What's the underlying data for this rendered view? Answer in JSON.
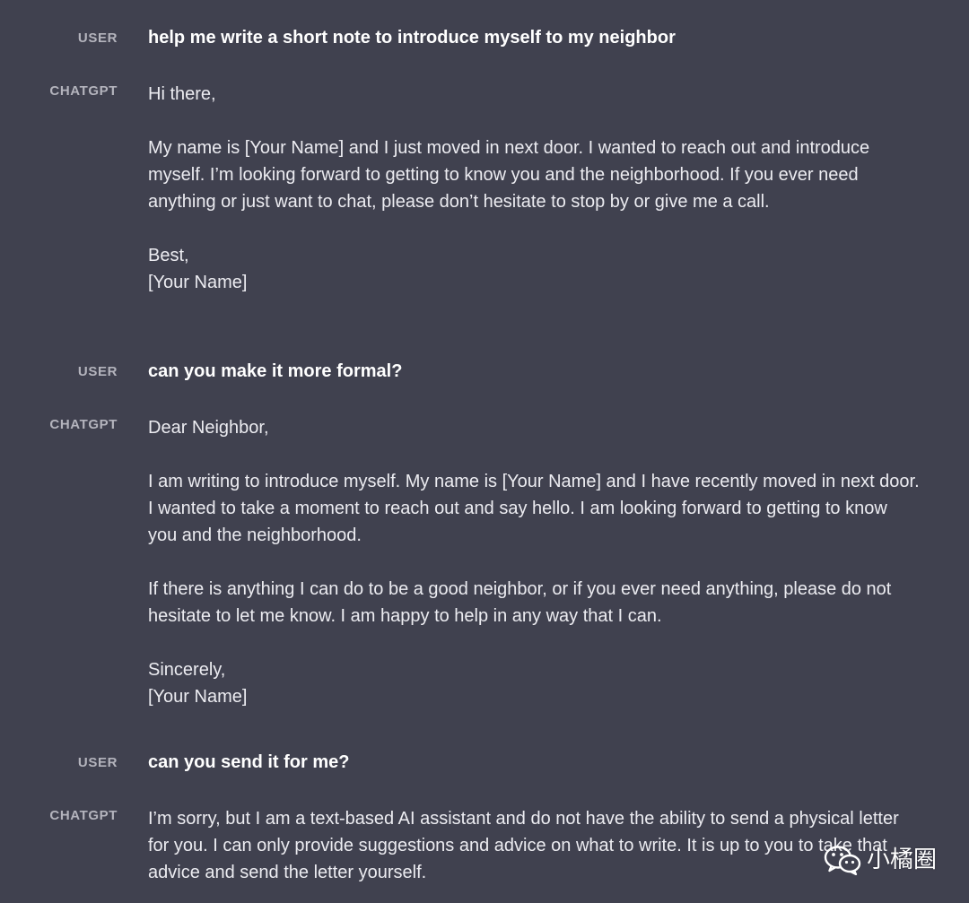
{
  "conversation": [
    {
      "role": "USER",
      "text": "help me write a short note to introduce myself to my neighbor"
    },
    {
      "role": "CHATGPT",
      "text": "Hi there,\n\nMy name is [Your Name] and I just moved in next door. I wanted to reach out and introduce myself. I’m looking forward to getting to know you and the neighborhood. If you ever need anything or just want to chat, please don’t hesitate to stop by or give me a call.\n\nBest,\n[Your Name]"
    },
    {
      "role": "USER",
      "text": "can you make it more formal?"
    },
    {
      "role": "CHATGPT",
      "text": "Dear Neighbor,\n\nI am writing to introduce myself. My name is [Your Name] and I have recently moved in next door. I wanted to take a moment to reach out and say hello. I am looking forward to getting to know you and the neighborhood.\n\nIf there is anything I can do to be a good neighbor, or if you ever need anything, please do not hesitate to let me know. I am happy to help in any way that I can.\n\nSincerely,\n[Your Name]"
    },
    {
      "role": "USER",
      "text": "can you send it for me?"
    },
    {
      "role": "CHATGPT",
      "text": "I’m sorry, but I am a text-based AI assistant and do not have the ability to send a physical letter for you. I can only provide suggestions and advice on what to write. It is up to you to take that advice and send the letter yourself."
    }
  ],
  "watermark": {
    "text": "小橘圈",
    "icon": "wechat-icon"
  },
  "colors": {
    "background": "#40414f",
    "role_label": "#b4b4bd",
    "text": "#ececf1"
  }
}
